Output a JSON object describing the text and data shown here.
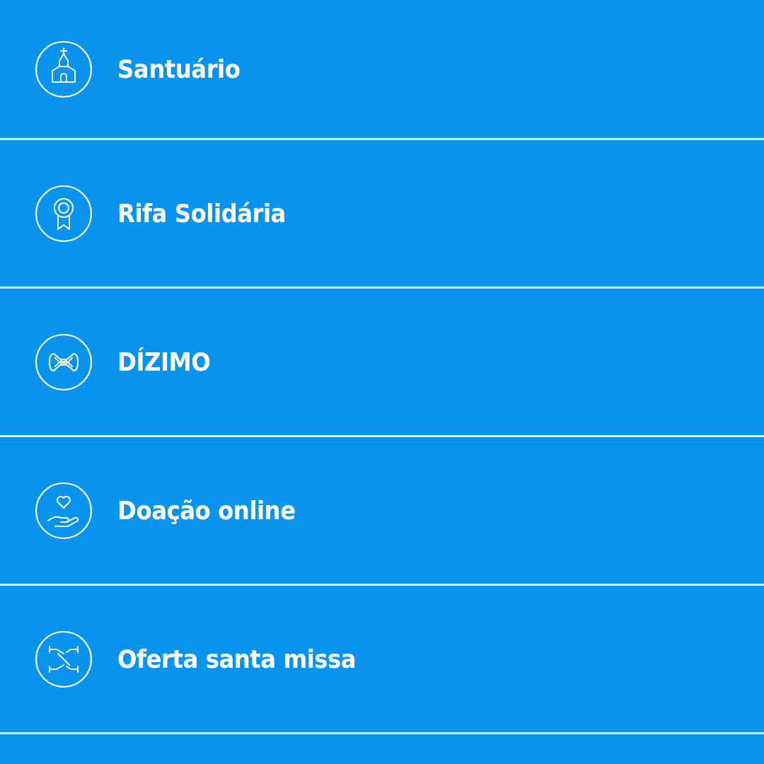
{
  "menu": {
    "items": [
      {
        "label": "Santuário"
      },
      {
        "label": "Rifa Solidária"
      },
      {
        "label": "DÍZIMO"
      },
      {
        "label": "Doação online"
      },
      {
        "label": "Oferta santa missa"
      }
    ]
  }
}
